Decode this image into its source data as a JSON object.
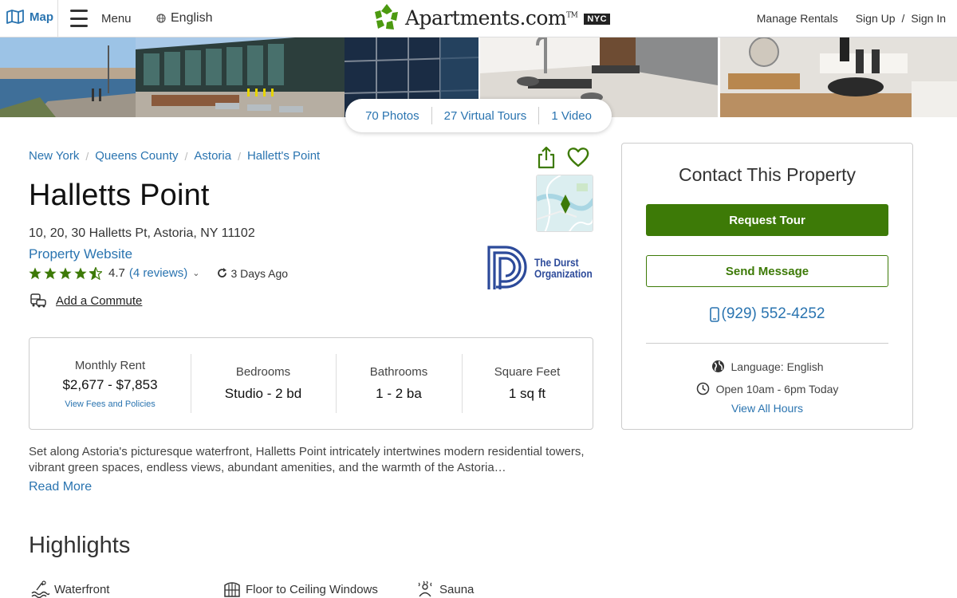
{
  "header": {
    "map_label": "Map",
    "menu_label": "Menu",
    "language_label": "English",
    "logo_text": "Apartments.com",
    "logo_tm": "TM",
    "logo_city": "NYC",
    "manage_rentals": "Manage Rentals",
    "sign_up": "Sign Up",
    "slash": "/",
    "sign_in": "Sign In"
  },
  "media": {
    "photos_label": "70 Photos",
    "tours_label": "27 Virtual Tours",
    "video_label": "1 Video"
  },
  "breadcrumb": [
    "New York",
    "Queens County",
    "Astoria",
    "Hallett's Point"
  ],
  "property": {
    "name": "Halletts Point",
    "address": "10, 20, 30 Halletts Pt, Astoria, NY 11102",
    "website_label": "Property Website",
    "rating_value": "4.7",
    "rating_stars": 4.5,
    "reviews_label": "(4 reviews)",
    "updated": "3 Days Ago",
    "commute_label": "Add a Commute",
    "logo_line1": "The Durst",
    "logo_line2": "Organization"
  },
  "stats": {
    "rent_label": "Monthly Rent",
    "rent_value": "$2,677 - $7,853",
    "fees_link": "View Fees and Policies",
    "bed_label": "Bedrooms",
    "bed_value": "Studio - 2 bd",
    "bath_label": "Bathrooms",
    "bath_value": "1 - 2 ba",
    "sqft_label": "Square Feet",
    "sqft_value": "1 sq ft"
  },
  "description": {
    "text": "Set along Astoria's picturesque waterfront, Halletts Point intricately intertwines modern residential towers, vibrant green spaces, endless views, abundant amenities, and the warmth of the Astoria…",
    "read_more": "Read More"
  },
  "highlights": {
    "title": "Highlights",
    "items": [
      "Waterfront",
      "Floor to Ceiling Windows",
      "Sauna"
    ]
  },
  "contact": {
    "title": "Contact This Property",
    "request_tour": "Request Tour",
    "send_message": "Send Message",
    "phone": "(929) 552-4252",
    "language": "Language: English",
    "hours": "Open 10am - 6pm Today",
    "view_hours": "View All Hours"
  },
  "colors": {
    "link_blue": "#2a74b0",
    "brand_green": "#3d7a07",
    "star_green": "#3d7a07"
  }
}
